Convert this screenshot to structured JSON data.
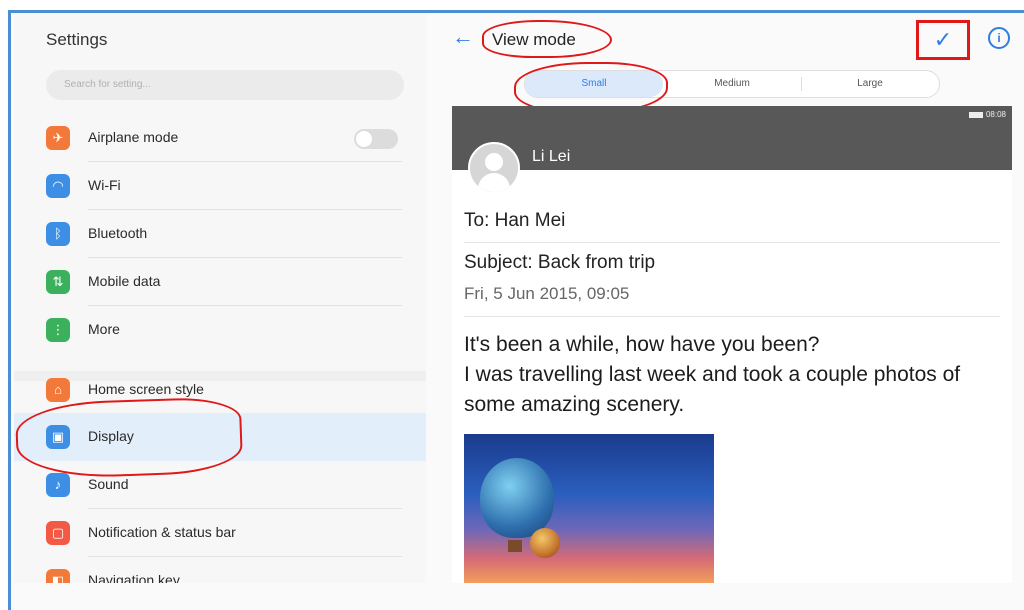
{
  "settings": {
    "title": "Settings",
    "search_placeholder": "Search for setting...",
    "items": [
      {
        "label": "Airplane mode",
        "icon": "airplane-icon",
        "color": "#f2793a"
      },
      {
        "label": "Wi-Fi",
        "icon": "wifi-icon",
        "color": "#3d8fe6"
      },
      {
        "label": "Bluetooth",
        "icon": "bluetooth-icon",
        "color": "#3d8fe6"
      },
      {
        "label": "Mobile data",
        "icon": "mobile-data-icon",
        "color": "#3cb15d"
      },
      {
        "label": "More",
        "icon": "more-icon",
        "color": "#3cb15d"
      },
      {
        "label": "Home screen style",
        "icon": "home-screen-icon",
        "color": "#f2793a"
      },
      {
        "label": "Display",
        "icon": "display-icon",
        "color": "#3d8fe6"
      },
      {
        "label": "Sound",
        "icon": "sound-icon",
        "color": "#3d8fe6"
      },
      {
        "label": "Notification & status bar",
        "icon": "notification-icon",
        "color": "#f25a45"
      },
      {
        "label": "Navigation key",
        "icon": "navigation-key-icon",
        "color": "#f2793a"
      }
    ]
  },
  "view_mode": {
    "title": "View mode",
    "options": [
      "Small",
      "Medium",
      "Large"
    ],
    "selected": "Small"
  },
  "preview": {
    "status_time": "08:08",
    "sender": "Li Lei",
    "to": "To: Han Mei",
    "subject": "Subject: Back from trip",
    "date": "Fri, 5 Jun 2015, 09:05",
    "body_line1": "It's been a while, how have you been?",
    "body_line2": "I was travelling last week and took a couple photos of some amazing scenery."
  },
  "colors": {
    "accent": "#2f7de0",
    "annotation_red": "#e01818",
    "frame_blue": "#4a8fd4"
  }
}
